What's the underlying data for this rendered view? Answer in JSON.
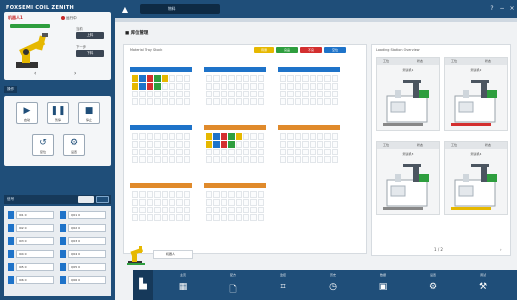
{
  "header": {
    "brand": "FOXSEMI  COIL  ZENITH",
    "status_left": "• 设备运行中",
    "status_right": "运行  25",
    "tab_title": "物料",
    "window_controls": [
      "?",
      "−",
      "×"
    ]
  },
  "sidebar": {
    "section_robot": "机器人状态",
    "robot_name": "机器人1",
    "robot_status": "运行中",
    "robot_labels": [
      "当前",
      "下一步"
    ],
    "robot_buttons": [
      "上料",
      "下料"
    ],
    "section_control": "操作",
    "controls": [
      {
        "label": "启动",
        "icon": "play-icon"
      },
      {
        "label": "暂停",
        "icon": "pause-icon"
      },
      {
        "label": "停止",
        "icon": "stop-icon"
      },
      {
        "label": "复位",
        "icon": "reset-icon"
      },
      {
        "label": "设置",
        "icon": "gear-icon"
      }
    ],
    "section_io": "信号",
    "io_rows": [
      {
        "left": "I01  0",
        "right": "Q01  0"
      },
      {
        "left": "I02  0",
        "right": "Q02  0"
      },
      {
        "left": "I03  0",
        "right": "Q03  0"
      },
      {
        "left": "I04  0",
        "right": "Q04  0"
      },
      {
        "left": "I05  0",
        "right": "Q05  0"
      },
      {
        "left": "I06  0",
        "right": "Q06  0"
      }
    ]
  },
  "main": {
    "page_title": "库位管理",
    "left_panel_caption": "Material Tray Stock",
    "legend": [
      {
        "label": "待测",
        "color": "#e6b800"
      },
      {
        "label": "良品",
        "color": "#2e9e3e"
      },
      {
        "label": "不良",
        "color": "#d32f2f"
      },
      {
        "label": "空位",
        "color": "#1e73c9"
      }
    ],
    "trays": [
      {
        "head_color": "#1e73c9",
        "filled": true
      },
      {
        "head_color": "#1e73c9",
        "filled": false
      },
      {
        "head_color": "#1e73c9",
        "filled": false
      },
      {
        "head_color": "#1e73c9",
        "filled": false
      },
      {
        "head_color": "#e08a2b",
        "filled": true
      },
      {
        "head_color": "#e08a2b",
        "filled": false
      },
      {
        "head_color": "#e08a2b",
        "filled": false
      },
      {
        "head_color": "#e08a2b",
        "filled": false
      }
    ],
    "right_panel_caption": "Loading Station Overview",
    "stations": [
      {
        "tab_a": "工位",
        "tab_b": "状态",
        "name": "测试机1",
        "bar_color": "#888888"
      },
      {
        "tab_a": "工位",
        "tab_b": "状态",
        "name": "测试机2",
        "bar_color": "#d32f2f"
      },
      {
        "tab_a": "工位",
        "tab_b": "状态",
        "name": "测试机3",
        "bar_color": "#888888"
      },
      {
        "tab_a": "工位",
        "tab_b": "状态",
        "name": "测试机4",
        "bar_color": "#e6b800"
      }
    ],
    "pager_text": "1 / 2",
    "mini_label": "机器人"
  },
  "bottom_nav": [
    {
      "label": "主页",
      "icon": "table-icon"
    },
    {
      "label": "配方",
      "icon": "doc-icon"
    },
    {
      "label": "监控",
      "icon": "monitor-icon"
    },
    {
      "label": "历史",
      "icon": "clock-icon"
    },
    {
      "label": "数据",
      "icon": "save-icon"
    },
    {
      "label": "设置",
      "icon": "gear-icon"
    },
    {
      "label": "调试",
      "icon": "tools-icon"
    }
  ],
  "colors": {
    "primary": "#1f4e79",
    "accent": "#1e73c9",
    "danger": "#d32f2f",
    "ok": "#2e9e3e",
    "warning": "#e6b800"
  }
}
